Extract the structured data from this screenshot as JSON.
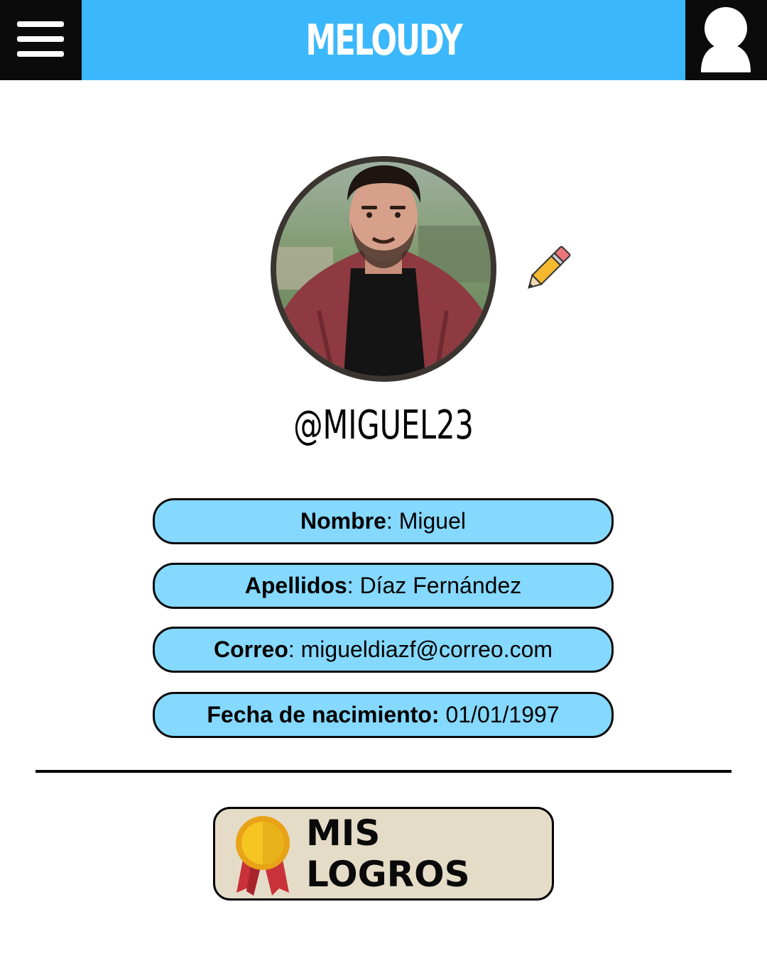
{
  "header": {
    "title": "MELOUDY",
    "menu_icon": "hamburger-menu-icon",
    "profile_icon": "user-icon",
    "colors": {
      "bar": "#3bb8fb",
      "buttons": "#0b0b0b"
    }
  },
  "profile": {
    "username": "@MIGUEL23",
    "edit_icon": "pencil-icon",
    "photo": "profile-photo"
  },
  "fields": [
    {
      "label": "Nombre",
      "sep": ":",
      "value": " Miguel"
    },
    {
      "label": "Apellidos",
      "sep": ":",
      "value": " Díaz Fernández"
    },
    {
      "label": "Correo",
      "sep": ":",
      "value": " migueldiazf@correo.com"
    },
    {
      "label": "Fecha de nacimiento:",
      "sep": "",
      "value": " 01/01/1997"
    }
  ],
  "field_color": "#85d9ff",
  "achievements": {
    "label": "MIS LOGROS",
    "icon": "medal-icon",
    "color": "#e5dcc8"
  }
}
